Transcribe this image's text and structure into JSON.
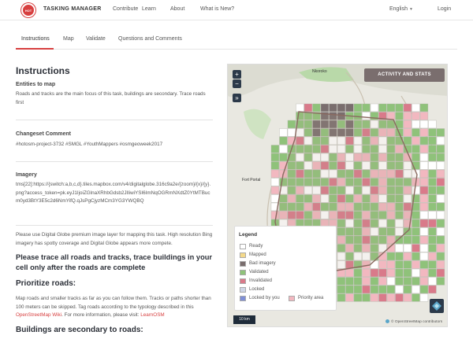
{
  "nav": {
    "logo_text": "HOT",
    "brand": "TASKING MANAGER",
    "links": [
      "Contribute",
      "Learn",
      "About",
      "What is New?"
    ],
    "language": "English",
    "login": "Login"
  },
  "tabs": [
    "Instructions",
    "Map",
    "Validate",
    "Questions and Comments"
  ],
  "content": {
    "heading": "Instructions",
    "entities_title": "Entities to map",
    "entities_text": "Roads and tracks are the main focus of this task, buildings are secondary. Trace roads first",
    "changeset_title": "Changeset Comment",
    "changeset_text": "#hotosm-project-3732 #SMGL #YouthMappers #osmgeoweek2017",
    "imagery_title": "Imagery",
    "imagery_text": "tms[22]:https://{switch:a,b,c,d}.tiles.mapbox.com/v4/digitalglobe.316c9a2e/{zoom}/{x}/{y}.png?access_token=pk.eyJ1IjoiZGlnaXRhbGdsb2JlIiwiYSI6ImNqOGRmNXdtZ0YtMTBucm0yd3BtY3E5c2d6NmYifQ.qJsPgCjyzMCm3YG3YWQBQ",
    "premium_text": "Please use Digital Globe premium image layer for mapping this task. High resolution Bing imagery has spotty coverage and Digital Globe appears more compete.",
    "trace_all": "Please trace all roads and tracks, trace buildings in your cell only after the roads are complete",
    "prioritize_title": "Prioritize roads:",
    "prioritize_text_a": "Map roads and smaller tracks as far as you can follow them. Tracks or paths shorter than 100 meters can be skipped. Tag roads according to the typology described in this",
    "prioritize_link1": "OpenStreetMap Wiki",
    "prioritize_text_b": ". For more information, please visit:",
    "prioritize_link2": "LearnOSM",
    "buildings_title": "Buildings are secondary to roads:"
  },
  "map": {
    "zoom_in": "+",
    "zoom_out": "−",
    "layer_toggle": "»",
    "activity_button": "ACTIVITY AND STATS",
    "place_1": "Nkoroko",
    "place_2": "Fort Portal",
    "scale": "10 km",
    "attribution": "© OpenStreetMap contributors",
    "legend": {
      "title": "Legend",
      "items": [
        {
          "label": "Ready",
          "color": "#ffffff"
        },
        {
          "label": "Mapped",
          "color": "#f4d98b"
        },
        {
          "label": "Bad imagery",
          "color": "#7a6e6e"
        },
        {
          "label": "Validated",
          "color": "#8fc27a"
        },
        {
          "label": "Invalidated",
          "color": "#d97a8a"
        },
        {
          "label": "Locked",
          "color": "#cfd6e6"
        },
        {
          "label": "Locked by you",
          "color": "#7f8fd6"
        },
        {
          "label": "Priority area",
          "color": "#f2b8c0"
        }
      ]
    }
  },
  "colors": {
    "accent": "#d73f3f",
    "validated": "#8fc27a",
    "invalidated": "#d97a8a"
  }
}
